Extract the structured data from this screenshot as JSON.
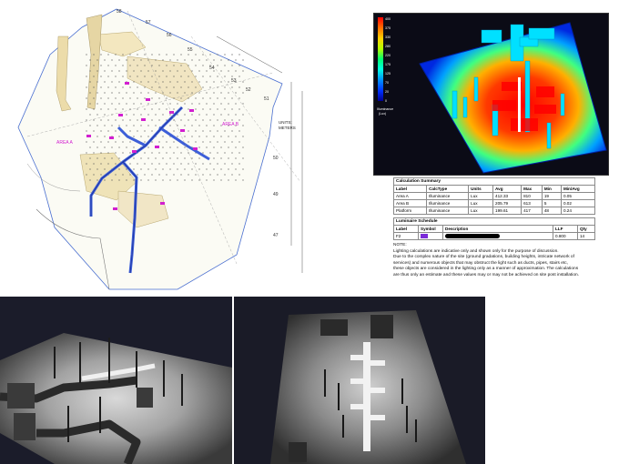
{
  "cad": {
    "grid_labels": [
      "58",
      "57",
      "56",
      "55",
      "54",
      "53",
      "52",
      "51",
      "50",
      "49",
      "47"
    ],
    "area_a": "AREA A",
    "area_b": "AREA B",
    "units_line1": "UNITS:",
    "units_line2": "METERS"
  },
  "legend": {
    "values": [
      "400",
      "375",
      "330",
      "280",
      "220",
      "175",
      "125",
      "70",
      "20",
      "0"
    ],
    "caption_line1": "Illuminance",
    "caption_line2": "(Lux)",
    "colors": [
      "#ff0000",
      "#ff5a00",
      "#ffaa00",
      "#ffff00",
      "#7dff00",
      "#00ff55",
      "#00ffd0",
      "#00aaff",
      "#0040ff",
      "#0000a0"
    ]
  },
  "calculation_summary": {
    "title": "Calculation Summary",
    "headers": [
      "Label",
      "CalcType",
      "Units",
      "Avg",
      "Max",
      "Min",
      "Min/Avg"
    ],
    "rows": [
      [
        "Area A",
        "Illuminance",
        "Lux",
        "412.33",
        "810",
        "19",
        "0.05"
      ],
      [
        "Area B",
        "Illuminance",
        "Lux",
        "205.79",
        "613",
        "5",
        "0.02"
      ],
      [
        "Platform",
        "Illuminance",
        "Lux",
        "199.61",
        "417",
        "48",
        "0.24"
      ]
    ]
  },
  "luminaire_schedule": {
    "title": "Luminaire Schedule",
    "headers": [
      "Label",
      "Symbol",
      "Description",
      "LLF",
      "Qty"
    ],
    "rows": [
      [
        "F2",
        "",
        "",
        "0.800",
        "14"
      ]
    ]
  },
  "notes": {
    "title": "NOTE:",
    "lines": [
      "Lighting calculations are indicative only and shown only for the purpose of discussion.",
      "Due to the complex nature of the site (ground gradations, building heights, intricate network of",
      "services) and numerous objects that may obstruct the light such as ducts, pipes, stairs etc,",
      "these objects are considered in the lighting only as a manner of approximation. The calculations",
      "are thus only an estimate and these values may or may not be achieved on site post installation."
    ]
  }
}
